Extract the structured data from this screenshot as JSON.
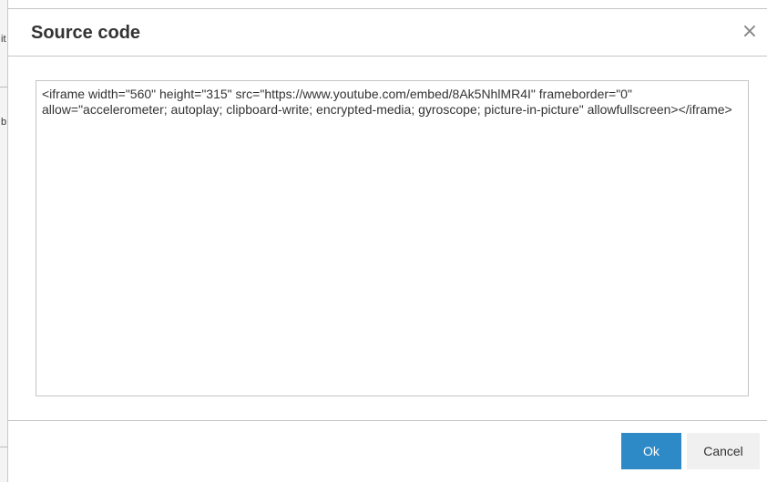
{
  "dialog": {
    "title": "Source code",
    "close_symbol": "×",
    "close_icon": "close-icon",
    "source_code": "<iframe width=\"560\" height=\"315\" src=\"https://www.youtube.com/embed/8Ak5NhlMR4I\" frameborder=\"0\" allow=\"accelerometer; autoplay; clipboard-write; encrypted-media; gyroscope; picture-in-picture\" allowfullscreen></iframe>",
    "ok_label": "Ok",
    "cancel_label": "Cancel"
  },
  "background": {
    "fragments": [
      "it",
      "b"
    ]
  },
  "colors": {
    "ok_button": "#2d8ac7",
    "cancel_button": "#f0f0f0",
    "border": "#c5c5c5"
  }
}
